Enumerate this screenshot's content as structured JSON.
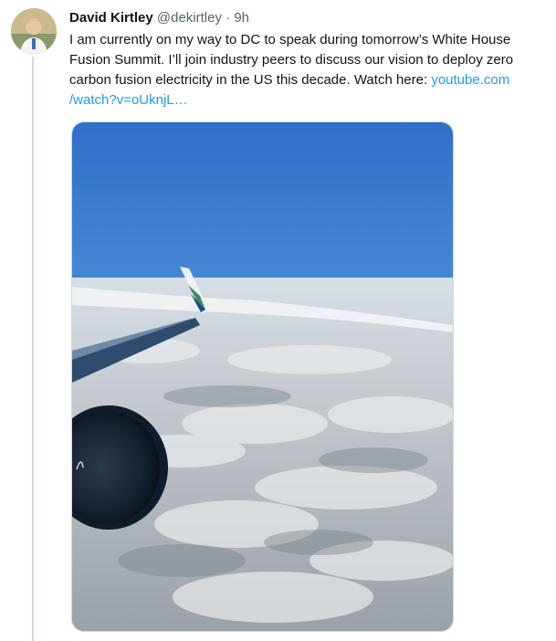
{
  "tweet": {
    "author_name": "David Kirtley",
    "author_handle": "@dekirtley",
    "separator": "·",
    "time": "9h",
    "lines": [
      "I am currently on my way to DC to speak during tomorrow’s White House",
      "Fusion Summit. I’ll join industry peers to discuss our vision to deploy zero",
      "carbon fusion electricity in the US this decade. Watch here: "
    ],
    "link_part1": "youtube.com",
    "link_part2": "/watch?v=oUknjL…",
    "media_description_icon": "photo-airplane-wing-over-clouds"
  },
  "colors": {
    "link": "#1d9bf0",
    "text": "#0f1419",
    "muted": "#536471",
    "thread": "#cfd9de"
  }
}
